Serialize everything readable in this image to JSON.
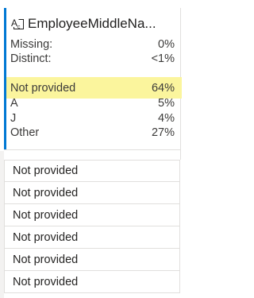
{
  "column": {
    "name": "EmployeeMiddleNa...",
    "type_icon": "text-type-icon"
  },
  "summary": {
    "missing_label": "Missing:",
    "missing_value": "0%",
    "distinct_label": "Distinct:",
    "distinct_value": "<1%"
  },
  "distribution": [
    {
      "label": "Not provided",
      "value": "64%"
    },
    {
      "label": "A",
      "value": "5%"
    },
    {
      "label": "J",
      "value": "4%"
    },
    {
      "label": "Other",
      "value": "27%"
    }
  ],
  "rows": [
    "Not provided",
    "Not provided",
    "Not provided",
    "Not provided",
    "Not provided",
    "Not provided"
  ],
  "colors": {
    "accent": "#0078d4",
    "highlight": "#fbf59d",
    "border": "#e1dfdd"
  }
}
